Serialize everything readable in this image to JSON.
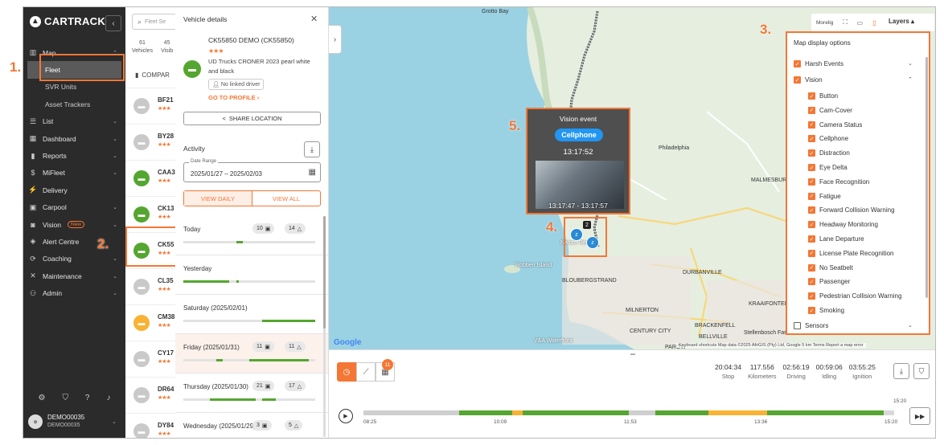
{
  "brand": {
    "name": "CARTRACK"
  },
  "nav": [
    {
      "label": "Map",
      "icon": "map-icon",
      "chev": "⌃"
    },
    {
      "label": "Fleet",
      "sub": true,
      "active": true
    },
    {
      "label": "SVR Units",
      "sub": true
    },
    {
      "label": "Asset Trackers",
      "sub": true
    },
    {
      "label": "List",
      "icon": "list-icon",
      "chev": "⌄"
    },
    {
      "label": "Dashboard",
      "icon": "dashboard-icon",
      "chev": "⌄"
    },
    {
      "label": "Reports",
      "icon": "reports-icon",
      "chev": "⌄"
    },
    {
      "label": "MiFleet",
      "icon": "dollar-icon",
      "chev": "⌄"
    },
    {
      "label": "Delivery",
      "icon": "delivery-icon"
    },
    {
      "label": "Carpool",
      "icon": "carpool-icon",
      "chev": "⌄"
    },
    {
      "label": "Vision",
      "icon": "vision-icon",
      "chev": "⌄",
      "badge": "New"
    },
    {
      "label": "Alert Centre",
      "icon": "alert-icon"
    },
    {
      "label": "Coaching",
      "icon": "coaching-icon",
      "chev": "⌄"
    },
    {
      "label": "Maintenance",
      "icon": "maintenance-icon",
      "chev": "⌄"
    },
    {
      "label": "Admin",
      "icon": "admin-icon",
      "chev": "⌄"
    }
  ],
  "user": {
    "name": "DEMO00035",
    "sub": "DEMO00035"
  },
  "fleet": {
    "search_placeholder": "Fleet Se",
    "counts": [
      {
        "value": "61",
        "label": "Vehicles"
      },
      {
        "value": "45",
        "label": "Visib"
      }
    ],
    "compare_label": "COMPAR",
    "vehicles": [
      {
        "name": "BF21",
        "color": "#c9c9c9"
      },
      {
        "name": "BY28",
        "color": "#c9c9c9"
      },
      {
        "name": "CAA3",
        "color": "#55a630"
      },
      {
        "name": "CK13",
        "color": "#55a630"
      },
      {
        "name": "CK55",
        "color": "#55a630"
      },
      {
        "name": "CL35",
        "color": "#c9c9c9"
      },
      {
        "name": "CM38",
        "color": "#f9b233"
      },
      {
        "name": "CY17",
        "color": "#c9c9c9"
      },
      {
        "name": "DR64",
        "color": "#c9c9c9"
      },
      {
        "name": "DY84",
        "color": "#c9c9c9"
      }
    ]
  },
  "details": {
    "header": "Vehicle details",
    "vehicle_title": "CK55850 DEMO (CK55850)",
    "model": "UD Trucks CRONER 2023 pearl white and black",
    "driver": "No linked driver",
    "profile_link": "GO TO PROFILE",
    "share": "SHARE LOCATION",
    "activity": "Activity",
    "date_range_label": "Date Range",
    "date_range": "2025/01/27 – 2025/02/03",
    "tabs": [
      "VIEW DAILY",
      "VIEW ALL"
    ],
    "days": [
      {
        "label": "Today",
        "p1": "10",
        "p2": "14"
      },
      {
        "label": "Yesterday",
        "p1": "",
        "p2": ""
      },
      {
        "label": "Saturday (2025/02/01)",
        "p1": "",
        "p2": ""
      },
      {
        "label": "Friday (2025/01/31)",
        "p1": "11",
        "p2": "11"
      },
      {
        "label": "Thursday (2025/01/30)",
        "p1": "21",
        "p2": "17"
      },
      {
        "label": "Wednesday (2025/01/29)",
        "p1": "3",
        "p2": "5"
      }
    ]
  },
  "map": {
    "labels": [
      "Grotto Bay",
      "Philadelphia",
      "MALMESBURY FARMS",
      "Robben Island",
      "BLOUBERGSTRAND",
      "DURBANVILLE",
      "MILNERTON",
      "KRAAIFONTEIN",
      "BRACKENFELL",
      "CENTURY CITY",
      "BELLVILLE",
      "V&A Waterfront",
      "PAROW",
      "Stellenbosch Farms",
      "Nature Rese"
    ],
    "google": "Google",
    "attribution": "Keyboard shortcuts   Map data ©2025 AfriGIS (Pty) Ltd, Google   5 km   Terms   Report a map error",
    "controls": {
      "morelig": "Morelig",
      "layers": "Layers"
    },
    "vision": {
      "title": "Vision event",
      "type": "Cellphone",
      "time": "13:17:52",
      "range": "13:17:47 - 13:17:57"
    },
    "cluster_count": "2",
    "callouts": [
      "1.",
      "2.",
      "3.",
      "4.",
      "5."
    ]
  },
  "layers": {
    "title": "Map display options",
    "groups": [
      {
        "label": "Harsh Events",
        "checked": true,
        "chev": "⌄"
      },
      {
        "label": "Vision",
        "checked": true,
        "chev": "⌃"
      }
    ],
    "vision_items": [
      "Button",
      "Cam-Cover",
      "Camera Status",
      "Cellphone",
      "Distraction",
      "Eye Delta",
      "Face Recognition",
      "Fatigue",
      "Forward Collision Warning",
      "Headway Monitoring",
      "Lane Departure",
      "License Plate Recognition",
      "No Seatbelt",
      "Passenger",
      "Pedestrian Collision Warning",
      "Smoking"
    ],
    "sensors": {
      "label": "Sensors",
      "checked": false,
      "chev": "⌄"
    }
  },
  "timeline": {
    "badge": "11",
    "stats": [
      {
        "value": "20:04:34",
        "label": "Stop"
      },
      {
        "value": "117.556",
        "label": "Kilometers"
      },
      {
        "value": "02:56:19",
        "label": "Driving"
      },
      {
        "value": "00:59:06",
        "label": "Idling"
      },
      {
        "value": "03:55:25",
        "label": "Ignition"
      }
    ],
    "ticks": [
      "08:25",
      "10:09",
      "11:53",
      "13:36",
      "15:20"
    ],
    "end_time": "15:20"
  },
  "colors": {
    "accent": "#f47735",
    "green": "#55a630",
    "blue": "#2196f3",
    "sidebar": "#2b2b2b"
  }
}
